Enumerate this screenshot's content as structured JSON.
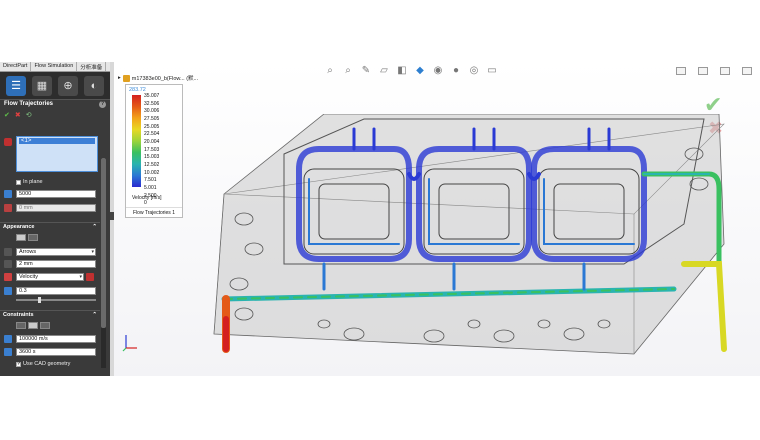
{
  "command_manager": {
    "tabs": [
      "DirectPart",
      "Flow Simulation",
      "分析准备"
    ]
  },
  "feature_manager": {
    "tabs": [
      {
        "icon": "feature-tree-icon",
        "active": true
      },
      {
        "icon": "property-icon"
      },
      {
        "icon": "globe-icon"
      },
      {
        "icon": "display-icon"
      }
    ]
  },
  "property_manager": {
    "title": "Flow Trajectories",
    "selection": {
      "item": "<1>"
    },
    "in_plane_label": "In plane",
    "points_value": "5000",
    "offset_value": "0 mm",
    "appearance": {
      "header": "Appearance",
      "draw_as": "Arrows",
      "size_value": "2 mm",
      "color_by": "Velocity",
      "width_value": "0.3"
    },
    "constraints": {
      "header": "Constraints",
      "max_length": "100000 m/s",
      "max_time": "3600 s",
      "use_cad_label": "Use CAD geometry"
    }
  },
  "viewport": {
    "model_name": "m17383e00_b(Flow... (默...",
    "hud_icons": [
      "zoom-fit-icon",
      "zoom-area-icon",
      "previous-view-icon",
      "section-view-icon",
      "view-orientation-icon",
      "display-style-icon",
      "hide-show-icon",
      "edit-appearance-icon",
      "scene-icon",
      "view-settings-icon"
    ]
  },
  "legend": {
    "top_value": "283.72",
    "values": [
      "35.007",
      "32.506",
      "30.006",
      "27.505",
      "25.005",
      "22.504",
      "20.004",
      "17.503",
      "15.003",
      "12.502",
      "10.002",
      "7.501",
      "5.001",
      "2.500",
      "0"
    ],
    "unit": "Velocity [m/s]",
    "name": "Flow Trajectories 1"
  },
  "colors": {
    "accent": "#2e6fb8",
    "panel_bg": "#3a3a3a",
    "ok": "#5fbf4a",
    "cancel": "#e04040"
  }
}
